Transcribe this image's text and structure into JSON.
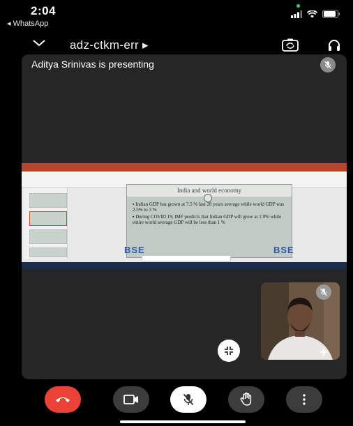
{
  "status_bar": {
    "time": "2:04",
    "back_app": "◂ WhatsApp"
  },
  "header": {
    "meeting_code": "adz-ctkm-err ▸"
  },
  "stage": {
    "presenter_text": "Aditya Srinivas is presenting"
  },
  "shared_slide": {
    "title": "India and world economy",
    "bullets": [
      "Indian GDP has grown at 7.5 % last 20 years average while world GDP was 2.5% to 3 %",
      "During COVID 19, IMF predicts that Indian GDP will grow at 1.9% while entire world average GDP will be less than 1 %"
    ],
    "logo_text": "BSE"
  },
  "controls": {
    "end_call": "end-call",
    "camera": "camera",
    "mic": "mic-off",
    "raise_hand": "raise-hand",
    "more": "more-options"
  },
  "colors": {
    "end_call": "#ea4335",
    "control_bg": "#3c3c3c",
    "stage_bg": "#262626"
  }
}
